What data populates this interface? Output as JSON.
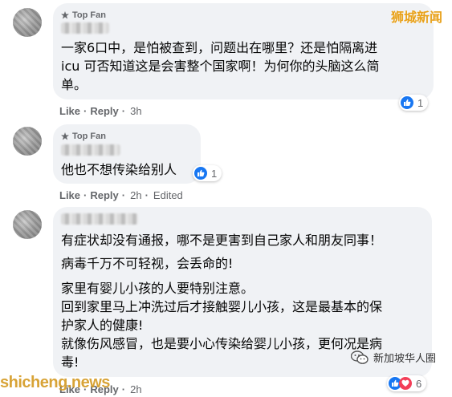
{
  "comments": [
    {
      "fan_label": "Top Fan",
      "lines": [
        "一家6口中，是怕被查到，问题出在哪里？还是怕隔离进",
        "icu 可否知道这是会害整个国家啊！为何你的头脑这么简",
        "单。"
      ],
      "like_label": "Like",
      "reply_label": "Reply",
      "time": "3h",
      "edited": "",
      "reaction_count": "1"
    },
    {
      "fan_label": "Top Fan",
      "lines": [
        "他也不想传染给别人"
      ],
      "like_label": "Like",
      "reply_label": "Reply",
      "time": "2h",
      "edited": "Edited",
      "reaction_count": "1"
    },
    {
      "fan_label": "",
      "lines": [
        "有症状却没有通报，哪不是更害到自己家人和朋友同事！",
        "病毒千万不可轻视，会丢命的!",
        "家里有婴儿小孩的人要特别注意。",
        "回到家里马上冲洗过后才接触婴儿小孩，这是最基本的保",
        "护家人的健康!",
        "就像伤风感冒，也是要小心传染给婴儿小孩，更何况是病",
        "毒!"
      ],
      "like_label": "Like",
      "reply_label": "Reply",
      "time": "2h",
      "edited": "",
      "reaction_count": "6"
    }
  ],
  "watermarks": {
    "top": "狮城新闻",
    "bottom": "shicheng.news",
    "wechat": "新加坡华人圈"
  },
  "colors": {
    "like_blue": "#1877f2",
    "bubble": "#f0f2f5",
    "meta_text": "#65676b"
  }
}
